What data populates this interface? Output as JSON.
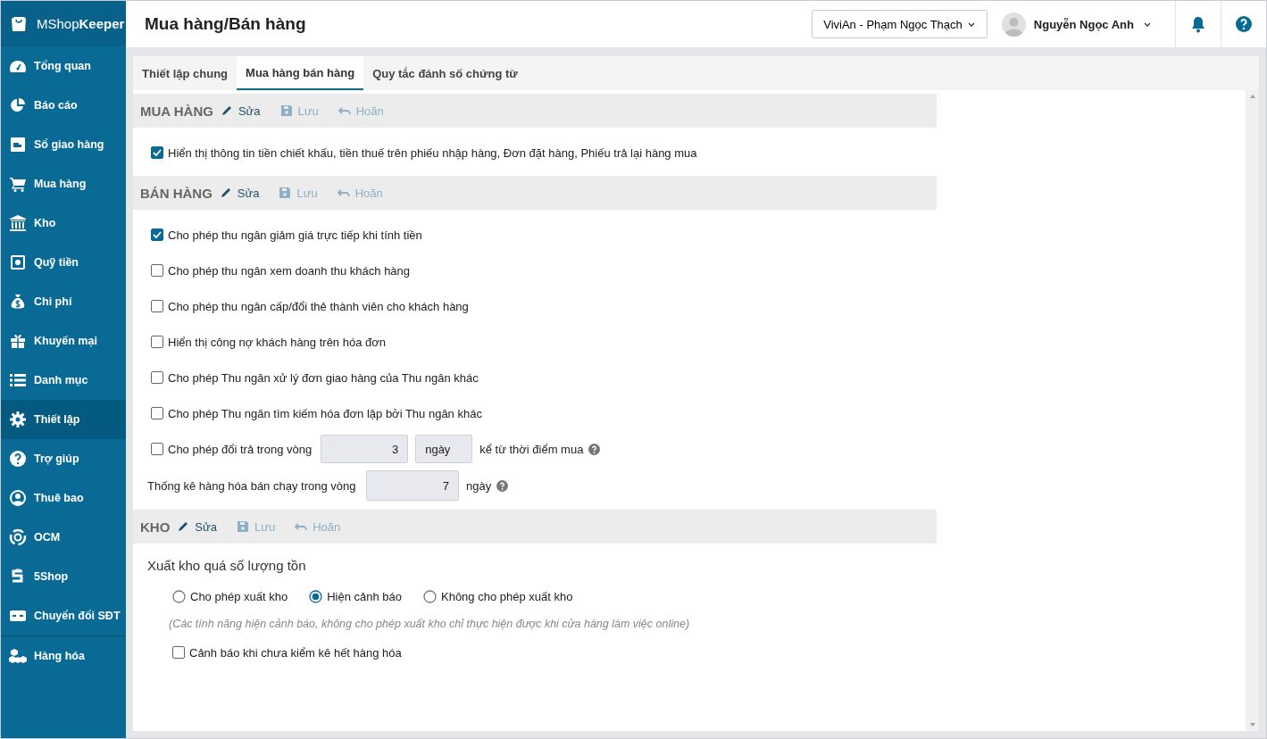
{
  "sidebar": {
    "brand": "MShop**Keeper**",
    "items": [
      {
        "label": "Tổng quan",
        "selected": false
      },
      {
        "label": "Báo cáo",
        "selected": false
      },
      {
        "label": "Sổ giao hàng",
        "selected": false
      },
      {
        "label": "Mua hàng",
        "selected": false
      },
      {
        "label": "Kho",
        "selected": false
      },
      {
        "label": "Quỹ tiền",
        "selected": false
      },
      {
        "label": "Chi phí",
        "selected": false
      },
      {
        "label": "Khuyến mại",
        "selected": false
      },
      {
        "label": "Danh mục",
        "selected": false
      },
      {
        "label": "Thiết lập",
        "selected": true
      },
      {
        "label": "Trợ giúp",
        "selected": false
      },
      {
        "label": "Thuê bao",
        "selected": false
      },
      {
        "label": "OCM",
        "selected": false
      },
      {
        "label": "5Shop",
        "selected": false
      },
      {
        "label": "Chuyển đổi SĐT",
        "selected": false
      },
      {
        "label": "Hàng hóa",
        "selected": false
      }
    ]
  },
  "header": {
    "title": "Mua hàng/Bán hàng",
    "store": "ViviAn - Phạm Ngọc Thạch",
    "user": "Nguyễn Ngọc Anh"
  },
  "tabs": [
    {
      "label": "Thiết lập chung",
      "selected": false
    },
    {
      "label": "Mua hàng bán hàng",
      "selected": true
    },
    {
      "label": "Quy tắc đánh số chứng từ",
      "selected": false
    }
  ],
  "sections": [
    {
      "title": "MUA HÀNG",
      "actions": [
        {
          "label": "Sửa",
          "disabled": false
        },
        {
          "label": "Lưu",
          "disabled": true
        },
        {
          "label": "Hoãn",
          "disabled": true
        }
      ],
      "items": [
        {
          "kind": "checkbox",
          "label": "Hiển thị thông tin tiền chiết khấu, tiền thuế trên phiếu nhập hàng, Đơn đặt hàng, Phiếu trả lại hàng mua",
          "checked": true
        }
      ]
    },
    {
      "title": "BÁN HÀNG",
      "actions": [
        {
          "label": "Sửa",
          "disabled": false
        },
        {
          "label": "Lưu",
          "disabled": true
        },
        {
          "label": "Hoãn",
          "disabled": true
        }
      ],
      "items": [
        {
          "kind": "checkbox",
          "label": "Cho phép thu ngân giảm giá trực tiếp khi tính tiền",
          "checked": true
        },
        {
          "kind": "checkbox",
          "label": "Cho phép thu ngân xem doanh thu khách hàng",
          "checked": false
        },
        {
          "kind": "checkbox",
          "label": "Cho phép thu ngân cấp/đổi thẻ thành viên cho khách hàng",
          "checked": false
        },
        {
          "kind": "checkbox",
          "label": "Hiển thị công nợ khách hàng trên hóa đơn",
          "checked": false
        },
        {
          "kind": "checkbox",
          "label": "Cho phép Thu ngân xử lý đơn giao hàng của Thu ngân khác",
          "checked": false
        },
        {
          "kind": "checkbox",
          "label": "Cho phép Thu ngân tìm kiếm hóa đơn lập bởi Thu ngân khác",
          "checked": false
        },
        {
          "kind": "period",
          "label": "Cho phép đổi trả trong vòng",
          "checked": false,
          "value": "3",
          "unit": "ngày",
          "suffix": "kể từ thời điểm mua"
        },
        {
          "kind": "number",
          "label": "Thống kê hàng hóa bán chạy trong vòng",
          "value": "7",
          "unit": "ngày"
        }
      ]
    },
    {
      "title": "KHO",
      "actions": [
        {
          "label": "Sửa",
          "disabled": false
        },
        {
          "label": "Lưu",
          "disabled": true
        },
        {
          "label": "Hoãn",
          "disabled": true
        }
      ],
      "items": [
        {
          "kind": "heading",
          "text": "Xuất kho quá số lượng tồn"
        },
        {
          "kind": "radios",
          "options": [
            {
              "label": "Cho phép xuất kho",
              "selected": false
            },
            {
              "label": "Hiện cảnh báo",
              "selected": true
            },
            {
              "label": "Không cho phép xuất kho",
              "selected": false
            }
          ]
        },
        {
          "kind": "note",
          "text": "(Các tính năng hiện cảnh báo, không cho phép xuất kho chỉ thực hiện được khi cửa hàng làm việc online)"
        },
        {
          "kind": "sub_checkbox",
          "label": "Cảnh báo khi chưa kiểm kê hết hàng hóa",
          "checked": false
        }
      ]
    }
  ]
}
